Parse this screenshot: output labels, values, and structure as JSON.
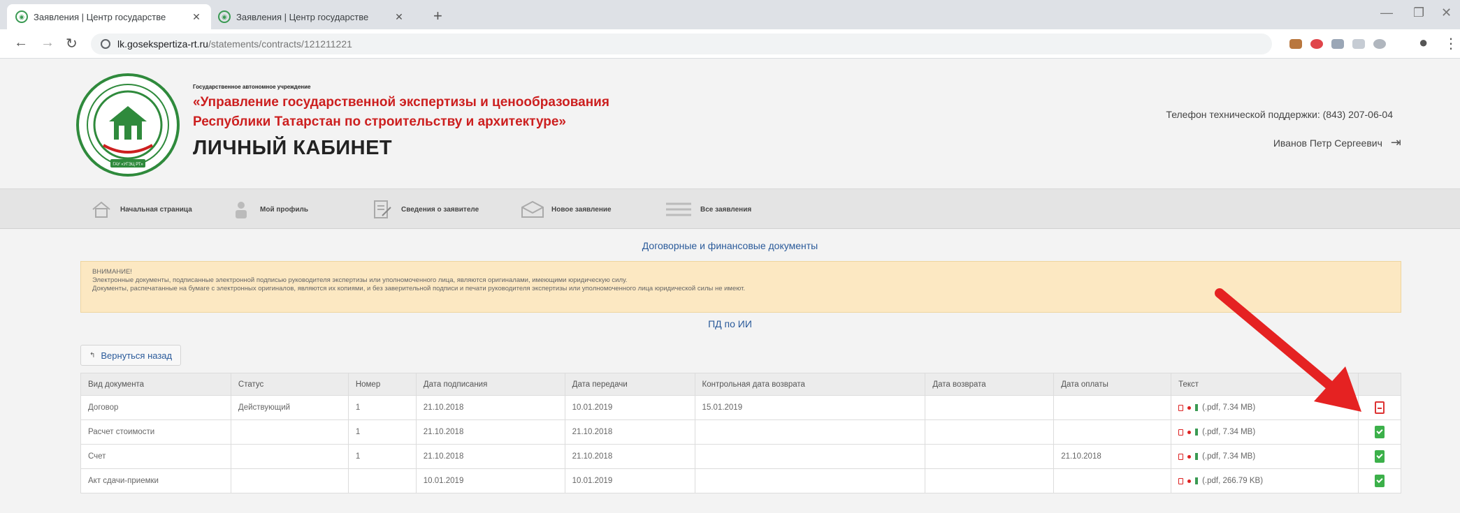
{
  "browser": {
    "tabs": [
      {
        "title": "Заявления | Центр государстве"
      },
      {
        "title": "Заявления | Центр государстве"
      }
    ],
    "new_tab": "+",
    "url_host": "lk.gosekspertiza-rt.ru",
    "url_path": "/statements/contracts/121211221"
  },
  "header": {
    "org_small": "Государственное автономное учреждение",
    "org_line1": "«Управление государственной экспертизы и ценообразования",
    "org_line2": "Республики Татарстан по строительству и архитектуре»",
    "cabinet": "ЛИЧНЫЙ КАБИНЕТ",
    "logo_text": "ГАУ «УГЭЦ РТ»",
    "phone": "Телефон технической поддержки: (843) 207-06-04",
    "user": "Иванов Петр Сергеевич"
  },
  "menu": {
    "items": [
      {
        "label": "Начальная страница",
        "icon": "home-icon"
      },
      {
        "label": "Мой профиль",
        "icon": "user-icon"
      },
      {
        "label": "Сведения о заявителе",
        "icon": "document-edit-icon"
      },
      {
        "label": "Новое заявление",
        "icon": "envelope-icon"
      },
      {
        "label": "Все заявления",
        "icon": "list-icon"
      }
    ]
  },
  "main": {
    "section_title": "Договорные и финансовые документы",
    "alert_title": "ВНИМАНИЕ!",
    "alert_line1": "Электронные документы, подписанные электронной подписью руководителя экспертизы или уполномоченного лица, являются оригиналами, имеющими юридическую силу.",
    "alert_line2": "Документы, распечатанные на бумаге с электронных оригиналов, являются их копиями, и без заверительной подписи и печати руководителя экспертизы или уполномоченного лица юридической силы не имеют.",
    "subsection_title": "ПД по ИИ",
    "back_label": "Вернуться назад"
  },
  "table": {
    "headers": [
      "Вид документа",
      "Статус",
      "Номер",
      "Дата подписания",
      "Дата передачи",
      "Контрольная дата возврата",
      "Дата возврата",
      "Дата оплаты",
      "Текст",
      ""
    ],
    "rows": [
      {
        "type": "Договор",
        "status": "Действующий",
        "number": "1",
        "signed": "21.10.2018",
        "transferred": "10.01.2019",
        "control_return": "15.01.2019",
        "returned": "",
        "paid": "",
        "file": "(.pdf, 7.34 MB)",
        "action": "red"
      },
      {
        "type": "Расчет стоимости",
        "status": "",
        "number": "1",
        "signed": "21.10.2018",
        "transferred": "21.10.2018",
        "control_return": "",
        "returned": "",
        "paid": "",
        "file": "(.pdf, 7.34 MB)",
        "action": "green"
      },
      {
        "type": "Счет",
        "status": "",
        "number": "1",
        "signed": "21.10.2018",
        "transferred": "21.10.2018",
        "control_return": "",
        "returned": "",
        "paid": "21.10.2018",
        "file": "(.pdf, 7.34 MB)",
        "action": "green"
      },
      {
        "type": "Акт сдачи-приемки",
        "status": "",
        "number": "",
        "signed": "10.01.2019",
        "transferred": "10.01.2019",
        "control_return": "",
        "returned": "",
        "paid": "",
        "file": "(.pdf, 266.79 KB)",
        "action": "green"
      }
    ]
  },
  "colors": {
    "accent_red": "#cc1f1f",
    "link_blue": "#2a5a9a",
    "alert_bg": "#fce8c2",
    "ok_green": "#3cb04a"
  }
}
